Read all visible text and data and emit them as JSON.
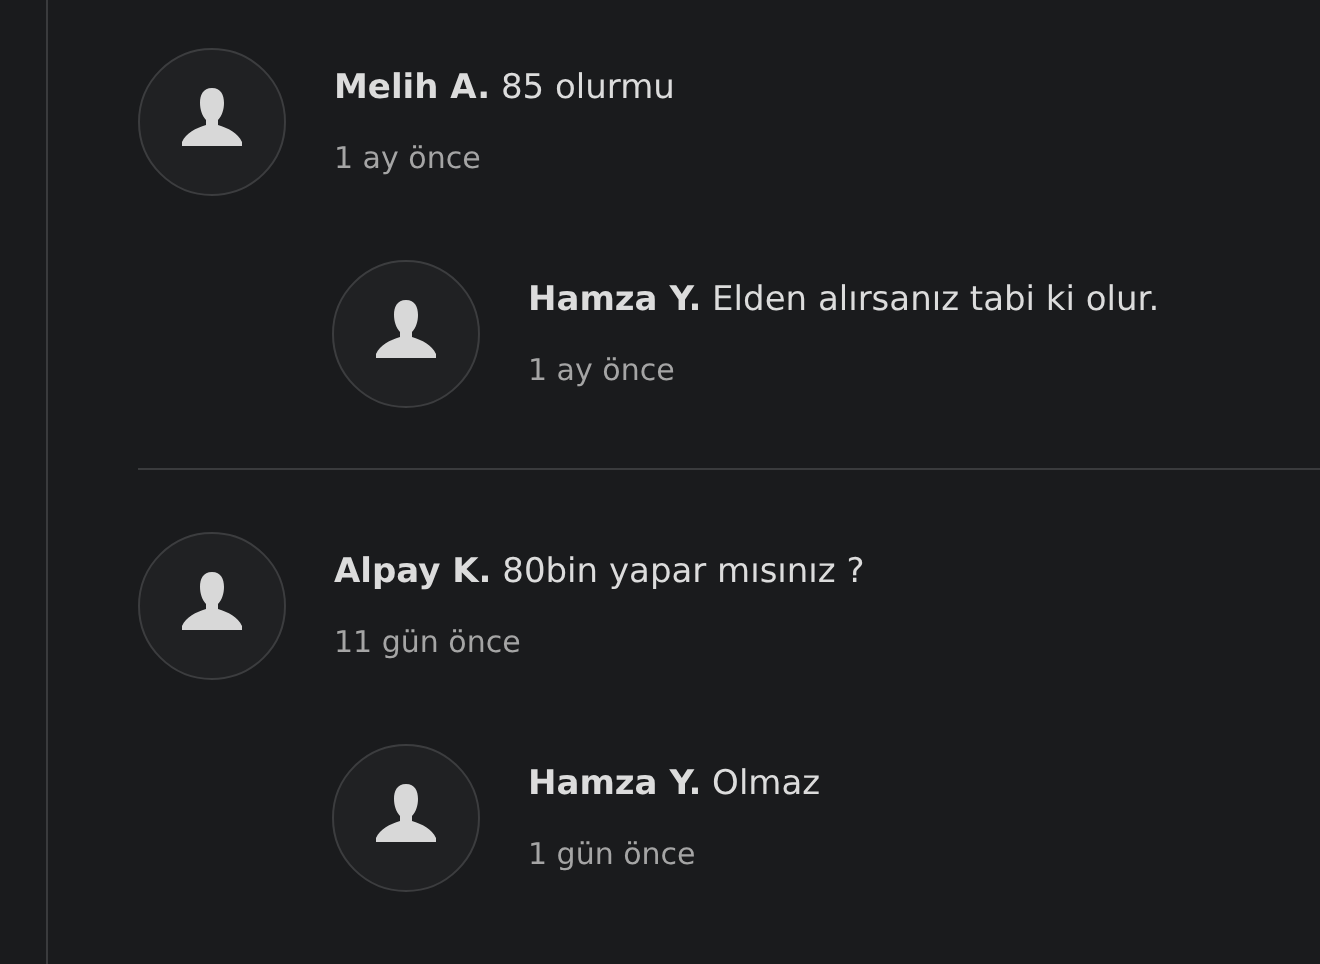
{
  "comments": [
    {
      "text": "**Melih A.** 85 olurmu",
      "time": "1 ay önce",
      "replies": [
        {
          "text": "**Hamza Y.** Elden alırsanız tabi ki olur.",
          "time": "1 ay önce"
        }
      ]
    },
    {
      "text": "**Alpay K.** 80bin yapar mısınız ?",
      "time": "11 gün önce",
      "replies": [
        {
          "text": "**Hamza Y.** Olmaz",
          "time": "1 gün önce"
        }
      ]
    }
  ]
}
